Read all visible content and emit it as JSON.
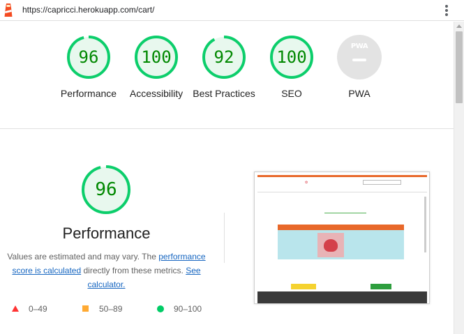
{
  "browser": {
    "url": "https://capricci.herokuapp.com/cart/",
    "menu_icon": "kebab-menu-icon",
    "logo_icon": "lighthouse-icon"
  },
  "categories": [
    {
      "label": "Performance",
      "score": "96",
      "value": 96
    },
    {
      "label": "Accessibility",
      "score": "100",
      "value": 100
    },
    {
      "label": "Best Practices",
      "score": "92",
      "value": 92
    },
    {
      "label": "SEO",
      "score": "100",
      "value": 100
    },
    {
      "label": "PWA",
      "badge": "PWA"
    }
  ],
  "performance": {
    "score": "96",
    "value": 96,
    "title": "Performance",
    "note_prefix": "Values are estimated and may vary. The ",
    "note_link1": "performance score is calculated",
    "note_middle": " directly from these metrics. ",
    "note_link2": "See calculator."
  },
  "legend": [
    {
      "range": "0–49",
      "color": "#ff3333",
      "shape": "triangle"
    },
    {
      "range": "50–89",
      "color": "#ffaa33",
      "shape": "square"
    },
    {
      "range": "90–100",
      "color": "#00cc66",
      "shape": "circle"
    }
  ],
  "colors": {
    "pass": "#0cce6b",
    "pass_text": "#008800",
    "pass_fill": "#e8f8ee",
    "pwa_gray": "#e3e3e3"
  }
}
